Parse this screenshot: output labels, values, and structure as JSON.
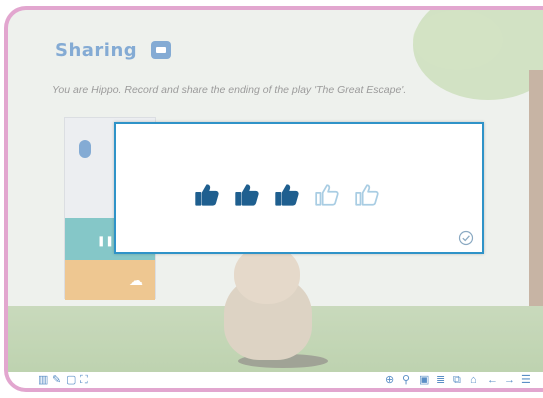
{
  "header": {
    "title": "Sharing",
    "instruction": "You are Hippo. Record and share the ending of the play 'The Great Escape'."
  },
  "rating": {
    "max": 5,
    "value": 3,
    "filled_color": "#1f5f8f",
    "empty_color": "#a9cde3"
  },
  "colors": {
    "frame": "#e2a6cf",
    "title": "#5b8fc6",
    "modal_border": "#2f93c8",
    "teal": "#5cb4b6",
    "orange": "#e9b56c"
  },
  "toolbar": {
    "left_icons": [
      "layout-icon",
      "pen-icon",
      "note-icon",
      "fullscreen-icon"
    ],
    "right_icons": [
      "zoom-icon",
      "tools-icon",
      "page-icon",
      "list-icon",
      "copy-icon",
      "home-icon",
      "back-arrow-icon",
      "forward-arrow-icon",
      "menu-icon"
    ]
  }
}
